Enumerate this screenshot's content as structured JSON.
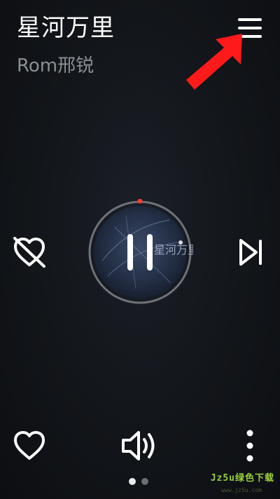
{
  "song": {
    "title": "星河万里",
    "artist": "Rom邢锐"
  },
  "icons": {
    "menu": "menu-icon",
    "arrow": "red-arrow-icon",
    "dislike": "heart-crossed-icon",
    "pause": "pause-icon",
    "next": "skip-next-icon",
    "like": "heart-icon",
    "volume": "volume-icon",
    "more": "more-vertical-icon"
  },
  "playback": {
    "state": "playing",
    "progress": 0.0
  },
  "album_art": {
    "text": "星河万里"
  },
  "pager": {
    "pages": 2,
    "current": 1
  },
  "watermark": {
    "text": "Jz5u绿色下载",
    "sub": "www.jz5u.com"
  },
  "colors": {
    "background": "#12151a",
    "text_primary": "#ffffff",
    "text_secondary": "#8b8e93",
    "accent_red": "#ff1a1a",
    "progress_marker": "#ff3b30",
    "watermark": "#9ad13c"
  }
}
